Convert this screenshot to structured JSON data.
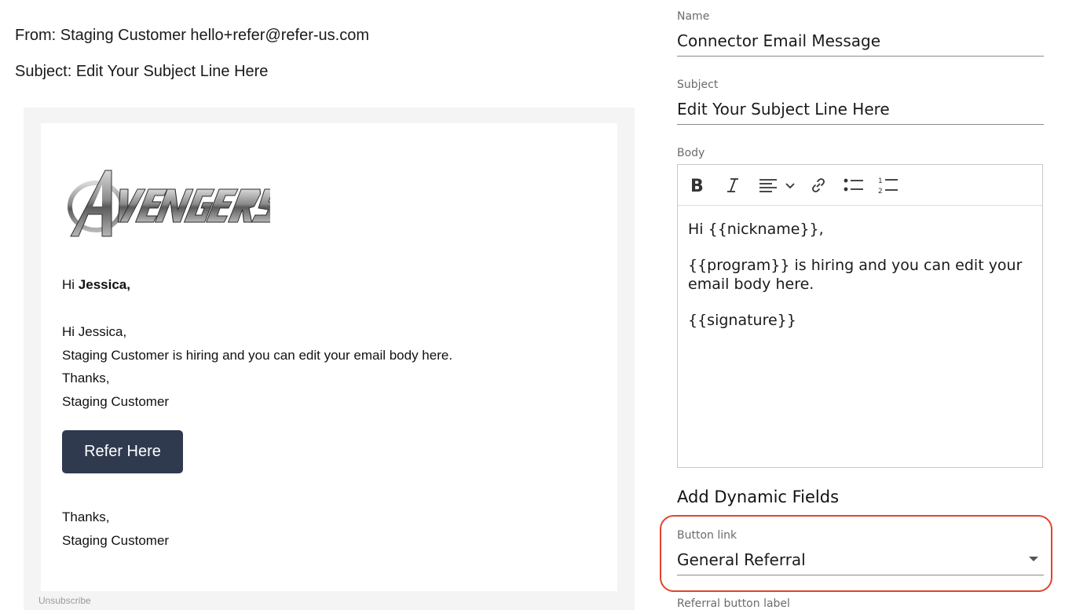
{
  "preview": {
    "from": "From: Staging Customer hello+refer@refer-us.com",
    "subject": "Subject: Edit Your Subject Line Here"
  },
  "email": {
    "logo_text": "AVENGERS",
    "greeting_prefix": "Hi",
    "greeting_name": "Jessica,",
    "body_lines": [
      "Hi Jessica,",
      "Staging Customer is hiring and you can edit your email body here.",
      "Thanks,",
      "Staging Customer"
    ],
    "button_label": "Refer Here",
    "closing_lines": [
      "Thanks,",
      "Staging Customer"
    ],
    "unsubscribe": "Unsubscribe"
  },
  "form": {
    "name_label": "Name",
    "name_value": "Connector Email Message",
    "subject_label": "Subject",
    "subject_value": "Edit Your Subject Line Here",
    "body_label": "Body",
    "toolbar": [
      "bold-icon",
      "italic-icon",
      "align-icon",
      "link-icon",
      "bullet-list-icon",
      "numbered-list-icon"
    ],
    "body_paragraphs": [
      "Hi {{nickname}},",
      "{{program}} is hiring and you can edit your email body here.",
      "{{signature}}"
    ],
    "dynamic_fields_title": "Add Dynamic Fields",
    "button_link_label": "Button link",
    "button_link_value": "General Referral",
    "referral_button_label": "Referral button label"
  },
  "colors": {
    "button_bg": "#2f3a4f",
    "highlight": "#e0442a"
  }
}
